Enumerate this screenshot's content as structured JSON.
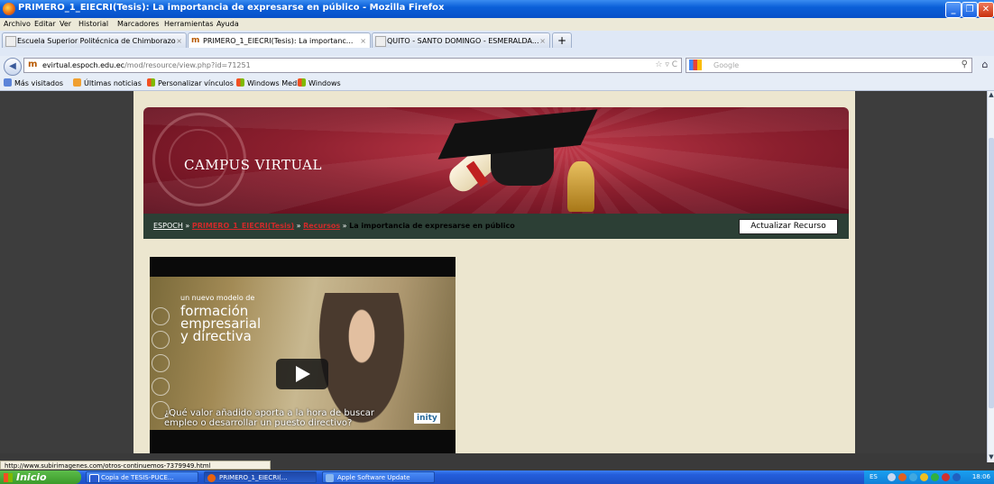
{
  "window": {
    "title": "PRIMERO_1_EIECRI(Tesis): La importancia de expresarse en público - Mozilla Firefox"
  },
  "menu": [
    "Archivo",
    "Editar",
    "Ver",
    "Historial",
    "Marcadores",
    "Herramientas",
    "Ayuda"
  ],
  "tabs": [
    {
      "label": "Escuela Superior Politécnica de Chimborazo",
      "active": false
    },
    {
      "label": "PRIMERO_1_EIECRI(Tesis): La importanc...",
      "active": true
    },
    {
      "label": "QUITO - SANTO DOMINGO - ESMERALDA...",
      "active": false
    }
  ],
  "navbar": {
    "url_domain": "evirtual.espoch.edu.ec",
    "url_path": "/mod/resource/view.php?id=71251",
    "search_placeholder": "Google"
  },
  "bookmarks": [
    "Más visitados",
    "Últimas noticias",
    "Personalizar vínculos",
    "Windows Media",
    "Windows"
  ],
  "page": {
    "banner_title": "CAMPUS VIRTUAL",
    "breadcrumb": {
      "home": "ESPOCH",
      "course": "PRIMERO_1_EIECRI(Tesis)",
      "section": "Recursos",
      "current": "La importancia de expresarse en público",
      "sep": "»"
    },
    "update_button": "Actualizar Recurso",
    "video": {
      "overlay_line0": "un nuevo modelo de",
      "overlay_line1": "formación",
      "overlay_line2": "empresarial",
      "overlay_line3": "y directiva",
      "caption_line1": "¿Qué valor añadido  aporta a la hora de buscar",
      "caption_line2": "empleo o desarrollar un puesto directivo?",
      "brand": "inity"
    }
  },
  "status_url": "http://www.subirimagenes.com/otros-continuemos-7379949.html",
  "taskbar": {
    "start": "Inicio",
    "tasks": [
      "Copia de TESIS-PUCE...",
      "PRIMERO_1_EIECRI(...",
      "Apple Software Update"
    ],
    "lang": "ES",
    "clock": "18:06"
  }
}
